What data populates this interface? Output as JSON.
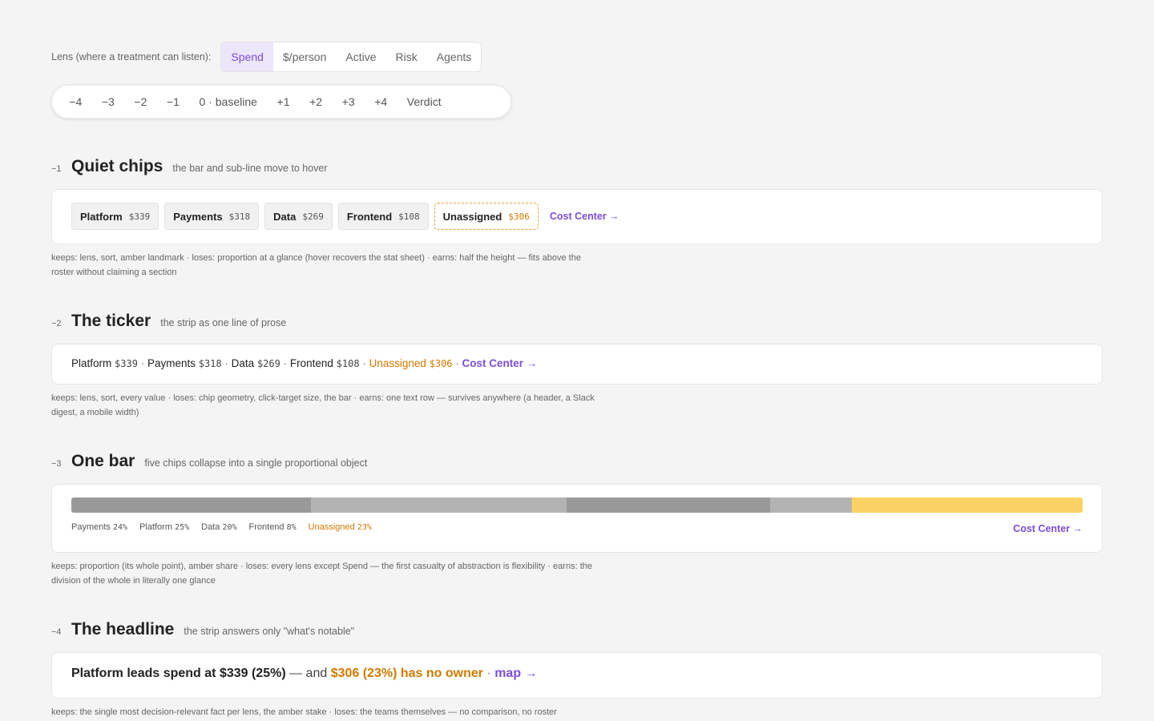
{
  "lens": {
    "label": "Lens (where a treatment can listen):",
    "options": [
      "Spend",
      "$/person",
      "Active",
      "Risk",
      "Agents"
    ],
    "active": "Spend",
    "accent_color": "#7c4ddb"
  },
  "steps": [
    "−4",
    "−3",
    "−2",
    "−1",
    "0 · baseline",
    "+1",
    "+2",
    "+3",
    "+4",
    "Verdict"
  ],
  "sections": {
    "quiet_chips": {
      "num": "−1",
      "title": "Quiet chips",
      "subtitle": "the bar and sub-line move to hover",
      "chips": [
        {
          "name": "Platform",
          "value": "$339"
        },
        {
          "name": "Payments",
          "value": "$318"
        },
        {
          "name": "Data",
          "value": "$269"
        },
        {
          "name": "Frontend",
          "value": "$108"
        },
        {
          "name": "Unassigned",
          "value": "$306"
        }
      ],
      "link": "Cost Center →",
      "note": "keeps: lens, sort, amber landmark · loses: proportion at a glance (hover recovers the stat sheet) · earns: half the height — fits above the roster without claiming a section"
    },
    "ticker": {
      "num": "−2",
      "title": "The ticker",
      "subtitle": "the strip as one line of prose",
      "items": [
        {
          "name": "Platform",
          "value": "$339"
        },
        {
          "name": "Payments",
          "value": "$318"
        },
        {
          "name": "Data",
          "value": "$269"
        },
        {
          "name": "Frontend",
          "value": "$108"
        },
        {
          "name": "Unassigned",
          "value": "$306"
        }
      ],
      "separator": " · ",
      "link": "Cost Center →",
      "note": "keeps: lens, sort, every value · loses: chip geometry, click-target size, the bar · earns: one text row — survives anywhere (a header, a Slack digest, a mobile width)"
    },
    "one_bar": {
      "num": "−3",
      "title": "One bar",
      "subtitle": "five chips collapse into a single proportional object",
      "segments": [
        {
          "share": 0.237,
          "color": "#999999"
        },
        {
          "share": 0.253,
          "color": "#b3b3b3"
        },
        {
          "share": 0.201,
          "color": "#999999"
        },
        {
          "share": 0.081,
          "color": "#b3b3b3"
        },
        {
          "share": 0.228,
          "color": "#fcd264"
        }
      ],
      "legend": [
        {
          "name": "Payments",
          "value": "24%"
        },
        {
          "name": "Platform",
          "value": "25%"
        },
        {
          "name": "Data",
          "value": "20%"
        },
        {
          "name": "Frontend",
          "value": "8%"
        },
        {
          "name": "Unassigned",
          "value": "23%"
        }
      ],
      "link": "Cost Center →",
      "note": "keeps: proportion (its whole point), amber share · loses: every lens except Spend — the first casualty of abstraction is flexibility · earns: the division of the whole in literally one glance"
    },
    "headline": {
      "num": "−4",
      "title": "The headline",
      "subtitle": "the strip answers only \"what's notable\"",
      "lead": "Platform leads spend at $339 (25%)",
      "mid": " — and ",
      "amber": "$306 (23%) has no owner",
      "dot": " · ",
      "link": "map →",
      "note": "keeps: the single most decision-relevant fact per lens, the amber stake · loses: the teams themselves — no comparison, no roster"
    }
  },
  "colors": {
    "amber": "#d27a00",
    "amber_bar": "#fcd264",
    "purple": "#7c4ddb"
  }
}
